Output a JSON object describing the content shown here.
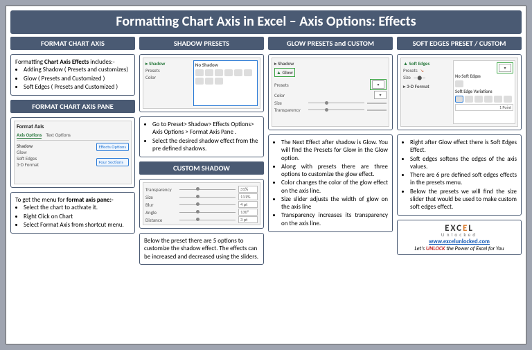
{
  "title": "Formatting Chart Axis in Excel – Axis Options: Effects",
  "col1": {
    "h1": "FORMAT CHART AXIS",
    "intro_lead": "Formatting ",
    "intro_bold": "Chart Axis Effects",
    "intro_tail": " includes:-",
    "bullets": [
      "Adding Shadow ( Presets and customizes)",
      "Glow ( Presets and Customized )",
      "Soft Edges ( Presets and Customized )"
    ],
    "h2": "FORMAT CHART AXIS PANE",
    "pane": {
      "title": "Format Axis",
      "tab1": "Axis Options",
      "tab2": "Text Options",
      "items": [
        "Shadow",
        "Glow",
        "Soft Edges",
        "3-D Format"
      ],
      "callout1": "Effects Options",
      "callout2": "Four Sections"
    },
    "steps_lead": "To get the menu for ",
    "steps_bold": "format axis pane:-",
    "steps": [
      "Select the chart to activate it.",
      "Right Click on Chart",
      "Select Format Axis from shortcut menu."
    ]
  },
  "col2": {
    "h1": "SHADOW PRESETS",
    "preset_label": "No Shadow",
    "bullets1": [
      "Go to Preset> Shadow> Effects Options> Axis Options > Format Axis Pane .",
      "Select the desired shadow effect from the pre defined shadows."
    ],
    "h2": "CUSTOM SHADOW",
    "sliders": [
      {
        "label": "Transparency",
        "val": "31%"
      },
      {
        "label": "Size",
        "val": "111%"
      },
      {
        "label": "Blur",
        "val": "4 pt"
      },
      {
        "label": "Angle",
        "val": "130°"
      },
      {
        "label": "Distance",
        "val": "3 pt"
      }
    ],
    "text2": "Below the preset there are 5 options to customize the shadow effect. The effects can be increased and decreased using the sliders."
  },
  "col3": {
    "h1": "GLOW PRESETS and CUSTOM",
    "panel": {
      "row1": "Shadow",
      "row2": "Glow",
      "labels": [
        "Presets",
        "Color",
        "Size",
        "Transparency"
      ]
    },
    "bullets": [
      "The Next Effect after shadow is Glow. You will find the Presets for Glow in the Glow option.",
      "Along with presets there are three options to customize the glow effect.",
      "Color changes the color of the glow effect on the axis line.",
      "Size slider adjusts the width of glow on the axis line",
      "Transparency increases its transparency on the axis line."
    ]
  },
  "col4": {
    "h1": "SOFT EDGES PRESET / CUSTOM",
    "panel": {
      "title": "Soft Edges",
      "presets": "Presets",
      "size": "Size",
      "fmt": "3-D Format",
      "no_soft": "No Soft Edges",
      "variations": "Soft Edge Variations",
      "point": "1 Point"
    },
    "bullets": [
      "Right after Glow effect there is Soft Edges Effect.",
      "Soft edges softens the edges of the axis values.",
      "There are 6 pre defined soft edges effects in the presets menu.",
      "Below the presets we will find the size slider that would be used to make custom soft edges effect."
    ],
    "footer": {
      "brand1": "EXC",
      "brand2": "E",
      "brand3": "L",
      "sub": "Unlocked",
      "url": "www.excelunlocked.com",
      "tag_pre": "Let's ",
      "tag_red": "UNLOCK",
      "tag_post": " the Power of Excel for You"
    }
  }
}
